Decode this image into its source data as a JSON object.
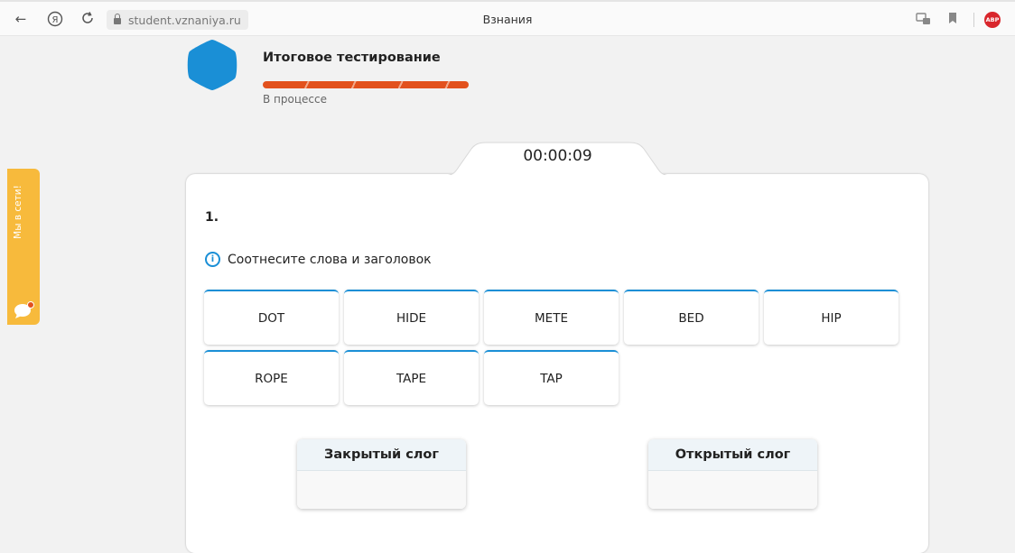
{
  "browser": {
    "url": "student.vznaniya.ru",
    "tab_title": "Взнания",
    "back_icon": "back-arrow-icon",
    "yandex_icon": "yandex-icon",
    "reload_icon": "reload-icon",
    "abp_label": "ABP"
  },
  "test": {
    "title": "Итоговое тестирование",
    "status": "В процессе",
    "progress": 1.0,
    "timer": "00:00:09",
    "accent_color": "#e2511d",
    "logo_color": "#1a8fd6"
  },
  "question": {
    "number": "1.",
    "hint": "Соотнесите слова и заголовок",
    "words": [
      "DOT",
      "HIDE",
      "METE",
      "BED",
      "HIP",
      "ROPE",
      "TAPE",
      "TAP"
    ],
    "categories": [
      {
        "title": "Закрытый слог"
      },
      {
        "title": "Открытый слог"
      }
    ]
  },
  "side_widget": {
    "label": "Мы в сети!",
    "color": "#f7ba3c"
  }
}
